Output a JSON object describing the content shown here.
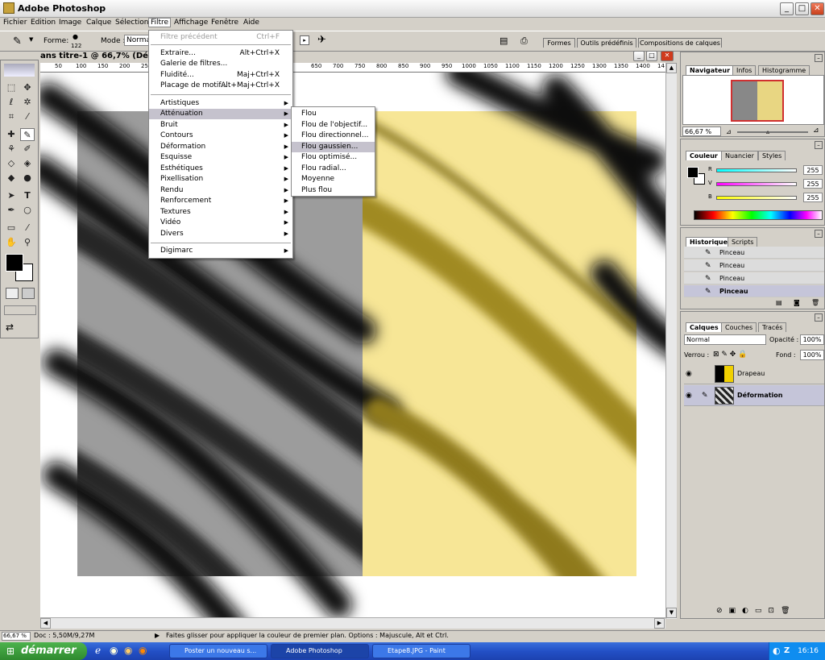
{
  "app": {
    "title": "Adobe Photoshop"
  },
  "menubar": [
    "Fichier",
    "Edition",
    "Image",
    "Calque",
    "Sélection",
    "Filtre",
    "Affichage",
    "Fenêtre",
    "Aide"
  ],
  "options": {
    "forme_label": "Forme:",
    "brush_size": "122",
    "mode_label": "Mode :",
    "mode_value": "Normal"
  },
  "top_tabs": [
    "Formes",
    "Outils prédéfinis",
    "Compositions de calques"
  ],
  "document": {
    "title": "ans titre-1 @ 66,7% (Défor"
  },
  "ruler_ticks": [
    "50",
    "100",
    "150",
    "200",
    "25",
    "650",
    "700",
    "750",
    "800",
    "850",
    "900",
    "950",
    "1000",
    "1050",
    "1100",
    "1150",
    "1200",
    "1250",
    "1300",
    "1350",
    "1400",
    "14"
  ],
  "filtre_menu": {
    "items": [
      {
        "label": "Filtre précédent",
        "shortcut": "Ctrl+F",
        "disabled": true
      },
      {
        "label": "Extraire...",
        "shortcut": "Alt+Ctrl+X"
      },
      {
        "label": "Galerie de filtres...",
        "shortcut": ""
      },
      {
        "label": "Fluidité...",
        "shortcut": "Maj+Ctrl+X"
      },
      {
        "label": "Placage de motif...",
        "shortcut": "Alt+Maj+Ctrl+X"
      },
      {
        "label": "Artistiques",
        "submenu": true
      },
      {
        "label": "Atténuation",
        "submenu": true,
        "highlighted": true
      },
      {
        "label": "Bruit",
        "submenu": true
      },
      {
        "label": "Contours",
        "submenu": true
      },
      {
        "label": "Déformation",
        "submenu": true
      },
      {
        "label": "Esquisse",
        "submenu": true
      },
      {
        "label": "Esthétiques",
        "submenu": true
      },
      {
        "label": "Pixellisation",
        "submenu": true
      },
      {
        "label": "Rendu",
        "submenu": true
      },
      {
        "label": "Renforcement",
        "submenu": true
      },
      {
        "label": "Textures",
        "submenu": true
      },
      {
        "label": "Vidéo",
        "submenu": true
      },
      {
        "label": "Divers",
        "submenu": true
      },
      {
        "label": "Digimarc",
        "submenu": true
      }
    ]
  },
  "attenuation_submenu": [
    "Flou",
    "Flou de l'objectif...",
    "Flou directionnel...",
    "Flou gaussien...",
    "Flou optimisé...",
    "Flou radial...",
    "Moyenne",
    "Plus flou"
  ],
  "navigator": {
    "tabs": [
      "Navigateur",
      "Infos",
      "Histogramme"
    ],
    "zoom": "66,67 %"
  },
  "color_panel": {
    "tabs": [
      "Couleur",
      "Nuancier",
      "Styles"
    ],
    "channels": [
      {
        "label": "R",
        "value": "255"
      },
      {
        "label": "V",
        "value": "255"
      },
      {
        "label": "B",
        "value": "255"
      }
    ]
  },
  "history_panel": {
    "tabs": [
      "Historique",
      "Scripts"
    ],
    "items": [
      "Pinceau",
      "Pinceau",
      "Pinceau",
      "Pinceau"
    ]
  },
  "layers_panel": {
    "tabs": [
      "Calques",
      "Couches",
      "Tracés"
    ],
    "blend_mode": "Normal",
    "opacity_label": "Opacité :",
    "opacity": "100%",
    "lock_label": "Verrou :",
    "fill_label": "Fond :",
    "fill": "100%",
    "layers": [
      {
        "name": "Drapeau"
      },
      {
        "name": "Déformation",
        "selected": true
      }
    ]
  },
  "status": {
    "zoom": "66,67 %",
    "doc": "Doc : 5,50M/9,27M",
    "hint": "Faites glisser pour appliquer la couleur de premier plan. Options : Majuscule, Alt et Ctrl."
  },
  "taskbar": {
    "start": "démarrer",
    "items": [
      "Poster un nouveau s...",
      "Adobe Photoshop",
      "Etape8.JPG - Paint"
    ],
    "clock": "16:16"
  }
}
